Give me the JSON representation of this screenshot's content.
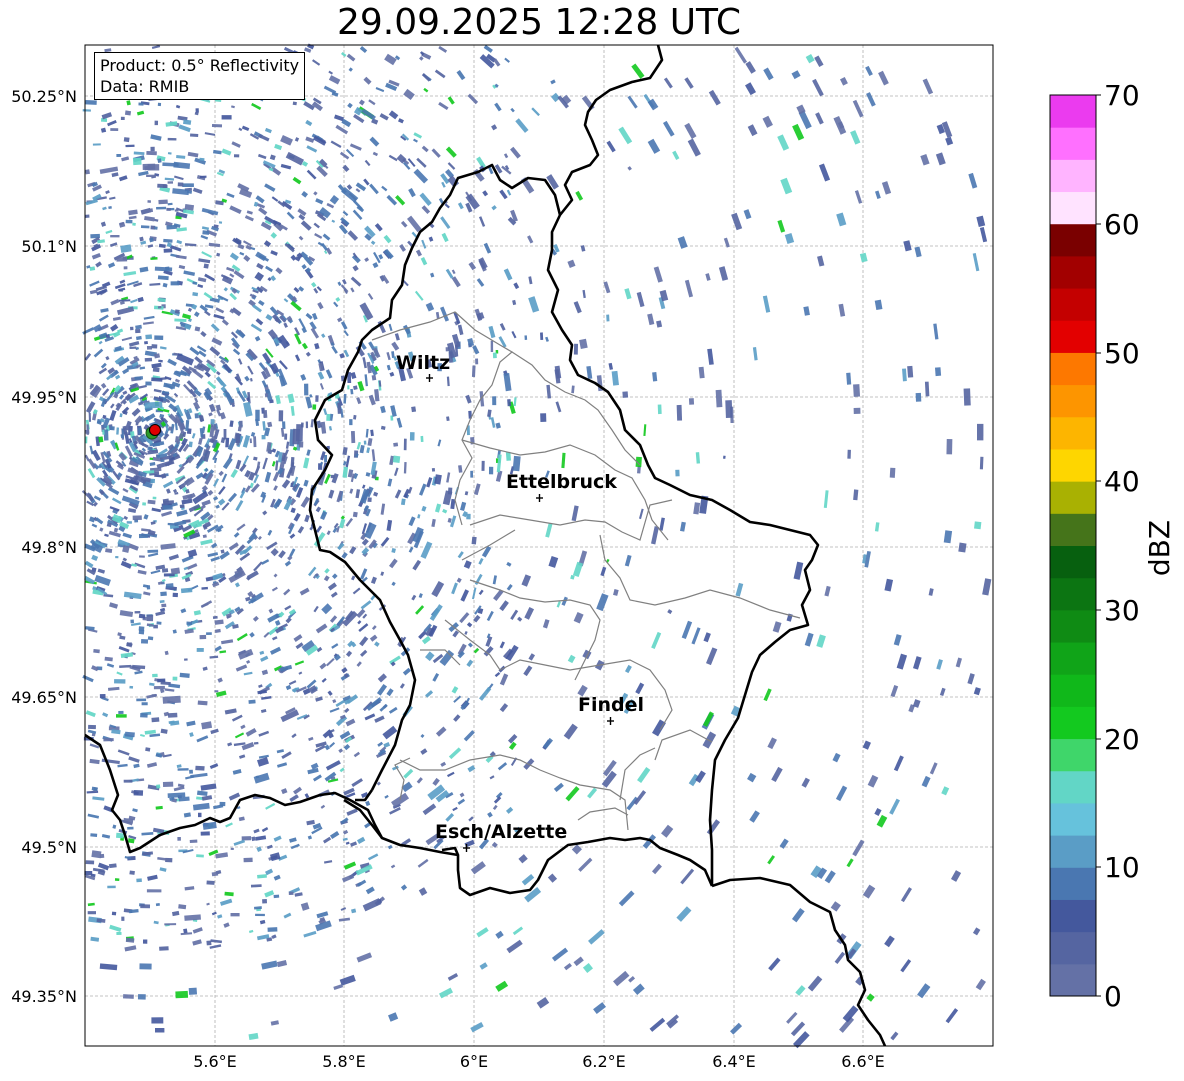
{
  "title": "29.09.2025 12:28 UTC",
  "info": {
    "product": "Product: 0.5° Reflectivity",
    "data": "Data: RMIB"
  },
  "axes": {
    "lat_ticks": [
      "50.25°N",
      "50.1°N",
      "49.95°N",
      "49.8°N",
      "49.65°N",
      "49.5°N",
      "49.35°N"
    ],
    "lon_ticks": [
      "5.6°E",
      "5.8°E",
      "6°E",
      "6.2°E",
      "6.4°E",
      "6.6°E"
    ]
  },
  "cities": [
    {
      "name": "Wiltz"
    },
    {
      "name": "Ettelbruck"
    },
    {
      "name": "Findel"
    },
    {
      "name": "Esch/Alzette"
    }
  ],
  "colorbar": {
    "label": "dBZ",
    "ticks": [
      "0",
      "10",
      "20",
      "30",
      "40",
      "50",
      "60",
      "70"
    ],
    "colors": [
      "#6471a6",
      "#5565a1",
      "#44589d",
      "#4a77b1",
      "#5a9dc6",
      "#66c2dc",
      "#62d6c6",
      "#3fd66a",
      "#13c91f",
      "#10b81a",
      "#10a418",
      "#0f8b14",
      "#0c7512",
      "#07600f",
      "#45741a",
      "#a9b102",
      "#fed600",
      "#fdb500",
      "#fd9500",
      "#fd7800",
      "#e30000",
      "#c40000",
      "#a20000",
      "#7a0000",
      "#ffe3ff",
      "#ffb4ff",
      "#ff70ff",
      "#eb3bef"
    ]
  }
}
